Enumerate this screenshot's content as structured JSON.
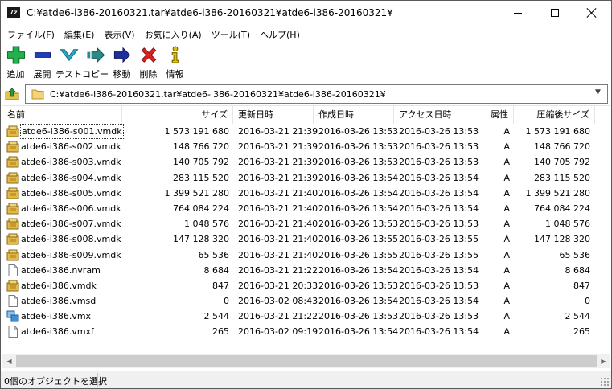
{
  "window": {
    "title": "C:¥atde6-i386-20160321.tar¥atde6-i386-20160321¥atde6-i386-20160321¥",
    "app_icon_text": "7z"
  },
  "menu": [
    "ファイル(F)",
    "編集(E)",
    "表示(V)",
    "お気に入り(A)",
    "ツール(T)",
    "ヘルプ(H)"
  ],
  "toolbar": {
    "add": "追加",
    "extract": "展開",
    "test": "テスト",
    "copy": "コピー",
    "move": "移動",
    "delete": "削除",
    "info": "情報"
  },
  "address": {
    "path": "C:¥atde6-i386-20160321.tar¥atde6-i386-20160321¥atde6-i386-20160321¥"
  },
  "columns": {
    "name": "名前",
    "size": "サイズ",
    "modified": "更新日時",
    "created": "作成日時",
    "accessed": "アクセス日時",
    "attributes": "属性",
    "packed_size": "圧縮後サイズ"
  },
  "files": [
    {
      "name": "atde6-i386-s001.vmdk",
      "size": "1 573 191 680",
      "modified": "2016-03-21 21:39",
      "created": "2016-03-26 13:53",
      "accessed": "2016-03-26 13:53",
      "attr": "A",
      "packed": "1 573 191 680",
      "icon": "vmdk-icon"
    },
    {
      "name": "atde6-i386-s002.vmdk",
      "size": "148 766 720",
      "modified": "2016-03-21 21:39",
      "created": "2016-03-26 13:53",
      "accessed": "2016-03-26 13:53",
      "attr": "A",
      "packed": "148 766 720",
      "icon": "vmdk-icon"
    },
    {
      "name": "atde6-i386-s003.vmdk",
      "size": "140 705 792",
      "modified": "2016-03-21 21:39",
      "created": "2016-03-26 13:53",
      "accessed": "2016-03-26 13:53",
      "attr": "A",
      "packed": "140 705 792",
      "icon": "vmdk-icon"
    },
    {
      "name": "atde6-i386-s004.vmdk",
      "size": "283 115 520",
      "modified": "2016-03-21 21:39",
      "created": "2016-03-26 13:54",
      "accessed": "2016-03-26 13:54",
      "attr": "A",
      "packed": "283 115 520",
      "icon": "vmdk-icon"
    },
    {
      "name": "atde6-i386-s005.vmdk",
      "size": "1 399 521 280",
      "modified": "2016-03-21 21:40",
      "created": "2016-03-26 13:54",
      "accessed": "2016-03-26 13:54",
      "attr": "A",
      "packed": "1 399 521 280",
      "icon": "vmdk-icon"
    },
    {
      "name": "atde6-i386-s006.vmdk",
      "size": "764 084 224",
      "modified": "2016-03-21 21:40",
      "created": "2016-03-26 13:54",
      "accessed": "2016-03-26 13:54",
      "attr": "A",
      "packed": "764 084 224",
      "icon": "vmdk-icon"
    },
    {
      "name": "atde6-i386-s007.vmdk",
      "size": "1 048 576",
      "modified": "2016-03-21 21:40",
      "created": "2016-03-26 13:53",
      "accessed": "2016-03-26 13:53",
      "attr": "A",
      "packed": "1 048 576",
      "icon": "vmdk-icon"
    },
    {
      "name": "atde6-i386-s008.vmdk",
      "size": "147 128 320",
      "modified": "2016-03-21 21:40",
      "created": "2016-03-26 13:55",
      "accessed": "2016-03-26 13:55",
      "attr": "A",
      "packed": "147 128 320",
      "icon": "vmdk-icon"
    },
    {
      "name": "atde6-i386-s009.vmdk",
      "size": "65 536",
      "modified": "2016-03-21 21:40",
      "created": "2016-03-26 13:55",
      "accessed": "2016-03-26 13:55",
      "attr": "A",
      "packed": "65 536",
      "icon": "vmdk-icon"
    },
    {
      "name": "atde6-i386.nvram",
      "size": "8 684",
      "modified": "2016-03-21 21:22",
      "created": "2016-03-26 13:54",
      "accessed": "2016-03-26 13:54",
      "attr": "A",
      "packed": "8 684",
      "icon": "file-icon"
    },
    {
      "name": "atde6-i386.vmdk",
      "size": "847",
      "modified": "2016-03-21 20:33",
      "created": "2016-03-26 13:53",
      "accessed": "2016-03-26 13:53",
      "attr": "A",
      "packed": "847",
      "icon": "vmdk-icon"
    },
    {
      "name": "atde6-i386.vmsd",
      "size": "0",
      "modified": "2016-03-02 08:43",
      "created": "2016-03-26 13:54",
      "accessed": "2016-03-26 13:54",
      "attr": "A",
      "packed": "0",
      "icon": "file-icon"
    },
    {
      "name": "atde6-i386.vmx",
      "size": "2 544",
      "modified": "2016-03-21 21:22",
      "created": "2016-03-26 13:53",
      "accessed": "2016-03-26 13:53",
      "attr": "A",
      "packed": "2 544",
      "icon": "vmx-icon"
    },
    {
      "name": "atde6-i386.vmxf",
      "size": "265",
      "modified": "2016-03-02 09:19",
      "created": "2016-03-26 13:54",
      "accessed": "2016-03-26 13:54",
      "attr": "A",
      "packed": "265",
      "icon": "file-icon"
    }
  ],
  "status": {
    "text": "0個のオブジェクトを選択"
  },
  "colors": {
    "add": "#22b14c",
    "extract": "#1f3fbf",
    "test": "#2aa8c8",
    "copy": "#2a8a8a",
    "move": "#1f2f9f",
    "delete": "#e02020",
    "info": "#e0c000"
  }
}
